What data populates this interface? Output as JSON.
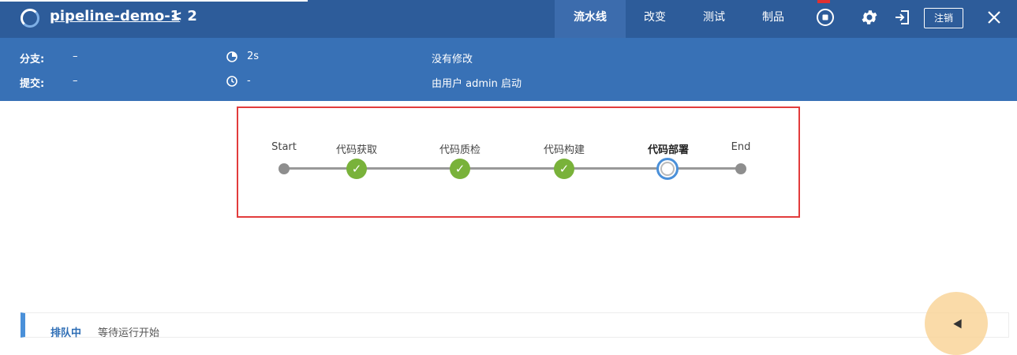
{
  "header": {
    "title": "pipeline-demo-1",
    "separator": "<",
    "run_number": "2",
    "tabs": [
      {
        "label": "流水线",
        "active": true
      },
      {
        "label": "改变",
        "active": false
      },
      {
        "label": "测试",
        "active": false
      },
      {
        "label": "制品",
        "active": false
      }
    ],
    "logout_label": "注销",
    "icons": {
      "run": "record-icon",
      "settings": "gear-icon",
      "exit": "exit-icon",
      "close": "close-icon"
    }
  },
  "info": {
    "branch_label": "分支:",
    "branch_value": "–",
    "commit_label": "提交:",
    "commit_value": "–",
    "duration": "2s",
    "time": "-",
    "changes": "没有修改",
    "cause": "由用户 admin 启动"
  },
  "pipeline": {
    "stages": [
      {
        "label": "Start",
        "status": "start"
      },
      {
        "label": "代码获取",
        "status": "success"
      },
      {
        "label": "代码质检",
        "status": "success"
      },
      {
        "label": "代码构建",
        "status": "success"
      },
      {
        "label": "代码部署",
        "status": "running"
      },
      {
        "label": "End",
        "status": "end"
      }
    ]
  },
  "queue": {
    "status": "排队中",
    "message": "等待运行开始"
  },
  "colors": {
    "header": "#2d5c9a",
    "info": "#3871b6",
    "success": "#79b23a",
    "running": "#4a90d9",
    "highlight": "#e23c3c"
  }
}
